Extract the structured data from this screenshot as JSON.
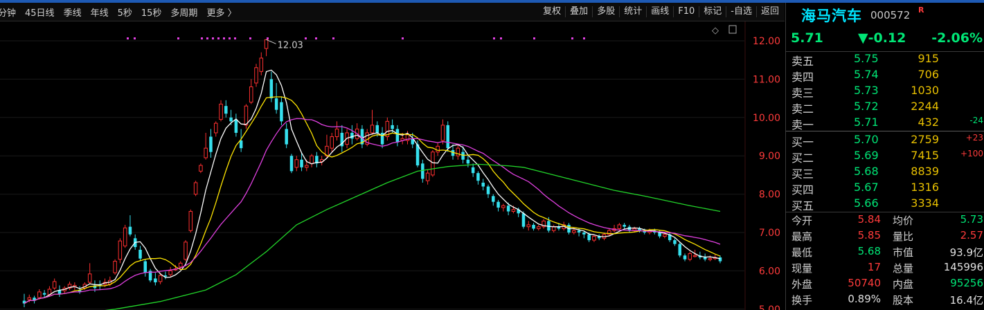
{
  "toolbar": {
    "tabs": [
      "分钟",
      "45日线",
      "季线",
      "年线",
      "5秒",
      "15秒",
      "多周期",
      "更多 〉"
    ],
    "actions": [
      "复权",
      "叠加",
      "多股",
      "统计",
      "画线",
      "F10",
      "标记",
      "-自选",
      "返回"
    ]
  },
  "chart_data": {
    "type": "candlestick",
    "y_ticks": [
      "12.00",
      "11.00",
      "10.00",
      "9.00",
      "8.00",
      "7.00",
      "6.00",
      "5.00"
    ],
    "ylim": [
      5.0,
      12.2
    ],
    "high_marker": "12.03",
    "candles": [
      [
        5.22,
        5.15,
        5.4,
        5.05
      ],
      [
        5.25,
        5.3,
        5.38,
        5.18
      ],
      [
        5.3,
        5.22,
        5.35,
        5.15
      ],
      [
        5.3,
        5.45,
        5.52,
        5.25
      ],
      [
        5.42,
        5.38,
        5.5,
        5.3
      ],
      [
        5.38,
        5.52,
        5.6,
        5.35
      ],
      [
        5.55,
        5.72,
        5.8,
        5.5
      ],
      [
        5.5,
        5.4,
        5.62,
        5.32
      ],
      [
        5.48,
        5.55,
        5.6,
        5.4
      ],
      [
        5.55,
        5.65,
        5.72,
        5.5
      ],
      [
        5.58,
        5.62,
        5.7,
        5.5
      ],
      [
        5.5,
        5.46,
        5.6,
        5.4
      ],
      [
        5.55,
        5.65,
        5.7,
        5.5
      ],
      [
        5.7,
        5.92,
        6.2,
        5.65
      ],
      [
        5.62,
        5.55,
        5.75,
        5.45
      ],
      [
        5.65,
        5.6,
        5.75,
        5.5
      ],
      [
        5.65,
        5.7,
        5.8,
        5.58
      ],
      [
        5.65,
        5.75,
        5.85,
        5.6
      ],
      [
        5.95,
        6.25,
        6.3,
        5.9
      ],
      [
        6.3,
        6.78,
        6.85,
        6.2
      ],
      [
        6.65,
        7.12,
        7.2,
        6.6
      ],
      [
        7.15,
        6.95,
        7.45,
        6.9
      ],
      [
        6.85,
        6.62,
        6.95,
        6.55
      ],
      [
        6.55,
        6.32,
        6.65,
        6.25
      ],
      [
        6.25,
        5.95,
        6.3,
        5.85
      ],
      [
        6.0,
        5.75,
        6.05,
        5.7
      ],
      [
        5.8,
        5.7,
        5.95,
        5.62
      ],
      [
        5.72,
        5.88,
        5.95,
        5.65
      ],
      [
        5.88,
        5.85,
        5.98,
        5.78
      ],
      [
        5.9,
        6.0,
        6.1,
        5.85
      ],
      [
        6.05,
        6.05,
        6.15,
        6.0
      ],
      [
        6.1,
        6.2,
        6.25,
        6.05
      ],
      [
        6.3,
        6.75,
        6.8,
        6.25
      ],
      [
        7.05,
        7.55,
        7.6,
        7.0
      ],
      [
        8.0,
        8.3,
        8.35,
        7.95
      ],
      [
        8.6,
        8.75,
        8.8,
        8.55
      ],
      [
        8.95,
        9.2,
        9.6,
        8.9
      ],
      [
        9.5,
        9.1,
        9.7,
        8.95
      ],
      [
        9.6,
        9.85,
        9.9,
        9.5
      ],
      [
        9.95,
        10.35,
        10.45,
        9.9
      ],
      [
        10.3,
        10.1,
        10.45,
        10.0
      ],
      [
        10.0,
        9.9,
        10.2,
        9.8
      ],
      [
        9.95,
        9.6,
        10.1,
        9.5
      ],
      [
        9.4,
        9.2,
        9.7,
        9.1
      ],
      [
        9.8,
        10.3,
        10.35,
        9.7
      ],
      [
        10.4,
        10.8,
        11.0,
        10.35
      ],
      [
        10.9,
        11.3,
        11.4,
        10.8
      ],
      [
        11.2,
        11.55,
        11.7,
        11.1
      ],
      [
        11.8,
        12.03,
        12.03,
        11.6
      ],
      [
        11.0,
        10.5,
        11.2,
        10.4
      ],
      [
        10.5,
        10.2,
        10.9,
        10.1
      ],
      [
        10.4,
        9.9,
        10.55,
        9.8
      ],
      [
        9.7,
        9.3,
        9.85,
        9.2
      ],
      [
        9.0,
        8.6,
        9.05,
        8.55
      ],
      [
        8.7,
        8.9,
        9.0,
        8.6
      ],
      [
        8.9,
        8.7,
        9.1,
        8.6
      ],
      [
        8.7,
        8.75,
        8.9,
        8.6
      ],
      [
        8.8,
        9.0,
        9.05,
        8.7
      ],
      [
        9.0,
        8.8,
        9.1,
        8.7
      ],
      [
        8.85,
        8.9,
        9.0,
        8.75
      ],
      [
        9.0,
        9.25,
        9.55,
        8.95
      ],
      [
        9.2,
        9.5,
        9.6,
        9.1
      ],
      [
        9.5,
        9.7,
        9.9,
        9.4
      ],
      [
        9.6,
        9.25,
        9.8,
        9.1
      ],
      [
        9.3,
        9.6,
        9.7,
        9.2
      ],
      [
        9.6,
        9.45,
        9.8,
        9.3
      ],
      [
        9.45,
        9.7,
        9.85,
        9.4
      ],
      [
        9.7,
        9.3,
        9.8,
        9.2
      ],
      [
        9.3,
        9.6,
        9.7,
        9.25
      ],
      [
        9.6,
        9.8,
        10.2,
        9.55
      ],
      [
        9.8,
        9.6,
        9.9,
        9.5
      ],
      [
        9.6,
        9.3,
        9.75,
        9.2
      ],
      [
        9.5,
        9.9,
        10.0,
        9.4
      ],
      [
        9.8,
        9.7,
        9.95,
        9.6
      ],
      [
        9.7,
        9.35,
        9.8,
        9.25
      ],
      [
        9.4,
        9.45,
        9.6,
        9.3
      ],
      [
        9.4,
        9.55,
        9.65,
        9.3
      ],
      [
        9.45,
        9.3,
        9.6,
        9.2
      ],
      [
        9.3,
        8.75,
        9.4,
        8.7
      ],
      [
        8.8,
        8.4,
        8.9,
        8.3
      ],
      [
        8.35,
        8.55,
        8.65,
        8.25
      ],
      [
        8.5,
        9.1,
        9.15,
        8.45
      ],
      [
        9.1,
        9.25,
        9.35,
        9.0
      ],
      [
        9.4,
        9.8,
        9.95,
        9.3
      ],
      [
        9.8,
        9.2,
        9.9,
        9.1
      ],
      [
        9.15,
        9.0,
        9.3,
        8.9
      ],
      [
        9.0,
        9.2,
        9.3,
        8.9
      ],
      [
        9.1,
        8.9,
        9.25,
        8.8
      ],
      [
        8.9,
        8.8,
        9.0,
        8.7
      ],
      [
        8.7,
        8.55,
        8.8,
        8.45
      ],
      [
        8.55,
        8.35,
        8.6,
        8.25
      ],
      [
        8.3,
        8.2,
        8.4,
        8.1
      ],
      [
        8.2,
        8.0,
        8.25,
        7.9
      ],
      [
        7.95,
        7.8,
        8.0,
        7.7
      ],
      [
        7.8,
        7.65,
        7.85,
        7.55
      ],
      [
        7.65,
        7.7,
        7.75,
        7.55
      ],
      [
        7.7,
        7.55,
        7.78,
        7.45
      ],
      [
        7.55,
        7.6,
        7.7,
        7.5
      ],
      [
        7.6,
        7.5,
        7.65,
        7.4
      ],
      [
        7.5,
        7.15,
        7.55,
        7.1
      ],
      [
        7.15,
        7.2,
        7.3,
        7.05
      ],
      [
        7.2,
        7.1,
        7.25,
        7.05
      ],
      [
        7.1,
        7.15,
        7.2,
        7.05
      ],
      [
        7.15,
        7.3,
        7.35,
        7.1
      ],
      [
        7.3,
        7.05,
        7.4,
        7.0
      ],
      [
        7.05,
        7.15,
        7.2,
        7.0
      ],
      [
        7.15,
        7.1,
        7.25,
        7.05
      ],
      [
        7.1,
        7.2,
        7.28,
        7.05
      ],
      [
        7.2,
        7.0,
        7.25,
        6.95
      ],
      [
        7.0,
        7.05,
        7.12,
        6.95
      ],
      [
        7.05,
        7.0,
        7.1,
        6.9
      ],
      [
        7.0,
        6.95,
        7.05,
        6.85
      ],
      [
        6.95,
        6.8,
        7.0,
        6.75
      ],
      [
        6.8,
        6.9,
        6.95,
        6.75
      ],
      [
        6.9,
        6.85,
        6.95,
        6.8
      ],
      [
        6.85,
        6.95,
        7.0,
        6.8
      ],
      [
        6.95,
        7.05,
        7.1,
        6.9
      ],
      [
        7.05,
        7.1,
        7.2,
        7.0
      ],
      [
        7.1,
        7.2,
        7.25,
        7.05
      ],
      [
        7.2,
        7.15,
        7.25,
        7.1
      ],
      [
        7.15,
        7.05,
        7.2,
        7.0
      ],
      [
        7.05,
        7.1,
        7.15,
        7.0
      ],
      [
        7.1,
        7.05,
        7.15,
        7.0
      ],
      [
        7.05,
        7.0,
        7.1,
        6.95
      ],
      [
        7.0,
        7.05,
        7.1,
        6.95
      ],
      [
        7.05,
        7.0,
        7.1,
        6.95
      ],
      [
        7.0,
        6.9,
        7.05,
        6.85
      ],
      [
        6.9,
        6.95,
        7.0,
        6.85
      ],
      [
        6.95,
        6.8,
        7.0,
        6.75
      ],
      [
        6.8,
        6.7,
        6.85,
        6.65
      ],
      [
        6.7,
        6.4,
        6.75,
        6.35
      ],
      [
        6.4,
        6.3,
        6.45,
        6.25
      ],
      [
        6.3,
        6.45,
        6.5,
        6.25
      ],
      [
        6.4,
        6.4,
        6.55,
        6.35
      ],
      [
        6.4,
        6.35,
        6.5,
        6.3
      ],
      [
        6.35,
        6.3,
        6.45,
        6.25
      ],
      [
        6.3,
        6.32,
        6.4,
        6.25
      ],
      [
        6.32,
        6.35,
        6.42,
        6.28
      ],
      [
        6.35,
        6.25,
        6.4,
        6.2
      ]
    ],
    "ma_colors": {
      "ma5": "#ffffff",
      "ma10": "#ffe500",
      "ma20": "#e040e0",
      "ma60": "#22d52a"
    },
    "ma60_path": [
      [
        0,
        4.7
      ],
      [
        30,
        4.85
      ],
      [
        60,
        5.0
      ],
      [
        90,
        5.2
      ],
      [
        120,
        5.5
      ],
      [
        140,
        5.9
      ],
      [
        160,
        6.5
      ],
      [
        180,
        7.2
      ],
      [
        200,
        7.6
      ],
      [
        220,
        7.95
      ],
      [
        240,
        8.3
      ],
      [
        260,
        8.6
      ],
      [
        280,
        8.72
      ],
      [
        300,
        8.78
      ],
      [
        320,
        8.74
      ],
      [
        330,
        8.7
      ],
      [
        350,
        8.5
      ],
      [
        370,
        8.3
      ],
      [
        390,
        8.1
      ],
      [
        410,
        7.95
      ],
      [
        440,
        7.7
      ],
      [
        460,
        7.55
      ]
    ]
  },
  "panel": {
    "name": "海马汽车",
    "code": "000572",
    "flag": "R",
    "price": "5.71",
    "change": "▼-0.12",
    "change_pct": "-2.06%",
    "asks": [
      {
        "label": "卖五",
        "price": "5.75",
        "vol": "915",
        "chg": ""
      },
      {
        "label": "卖四",
        "price": "5.74",
        "vol": "706",
        "chg": ""
      },
      {
        "label": "卖三",
        "price": "5.73",
        "vol": "1030",
        "chg": ""
      },
      {
        "label": "卖二",
        "price": "5.72",
        "vol": "2244",
        "chg": ""
      },
      {
        "label": "卖一",
        "price": "5.71",
        "vol": "432",
        "chg": "-24"
      }
    ],
    "bids": [
      {
        "label": "买一",
        "price": "5.70",
        "vol": "2759",
        "chg": "+23"
      },
      {
        "label": "买二",
        "price": "5.69",
        "vol": "7415",
        "chg": "+100"
      },
      {
        "label": "买三",
        "price": "5.68",
        "vol": "8839",
        "chg": ""
      },
      {
        "label": "买四",
        "price": "5.67",
        "vol": "1316",
        "chg": ""
      },
      {
        "label": "买五",
        "price": "5.66",
        "vol": "3334",
        "chg": ""
      }
    ],
    "stats": [
      {
        "l1": "今开",
        "v1": "5.84",
        "l2": "均价",
        "v2": "5.73"
      },
      {
        "l1": "最高",
        "v1": "5.85",
        "l2": "量比",
        "v2": "2.57"
      },
      {
        "l1": "最低",
        "v1": "5.68",
        "l2": "市值",
        "v2": "93.9亿"
      },
      {
        "l1": "现量",
        "v1": "17",
        "l2": "总量",
        "v2": "145996"
      },
      {
        "l1": "外盘",
        "v1": "50740",
        "l2": "内盘",
        "v2": "95256"
      },
      {
        "l1": "换手",
        "v1": "0.89%",
        "l2": "股本",
        "v2": "16.4亿"
      }
    ]
  }
}
